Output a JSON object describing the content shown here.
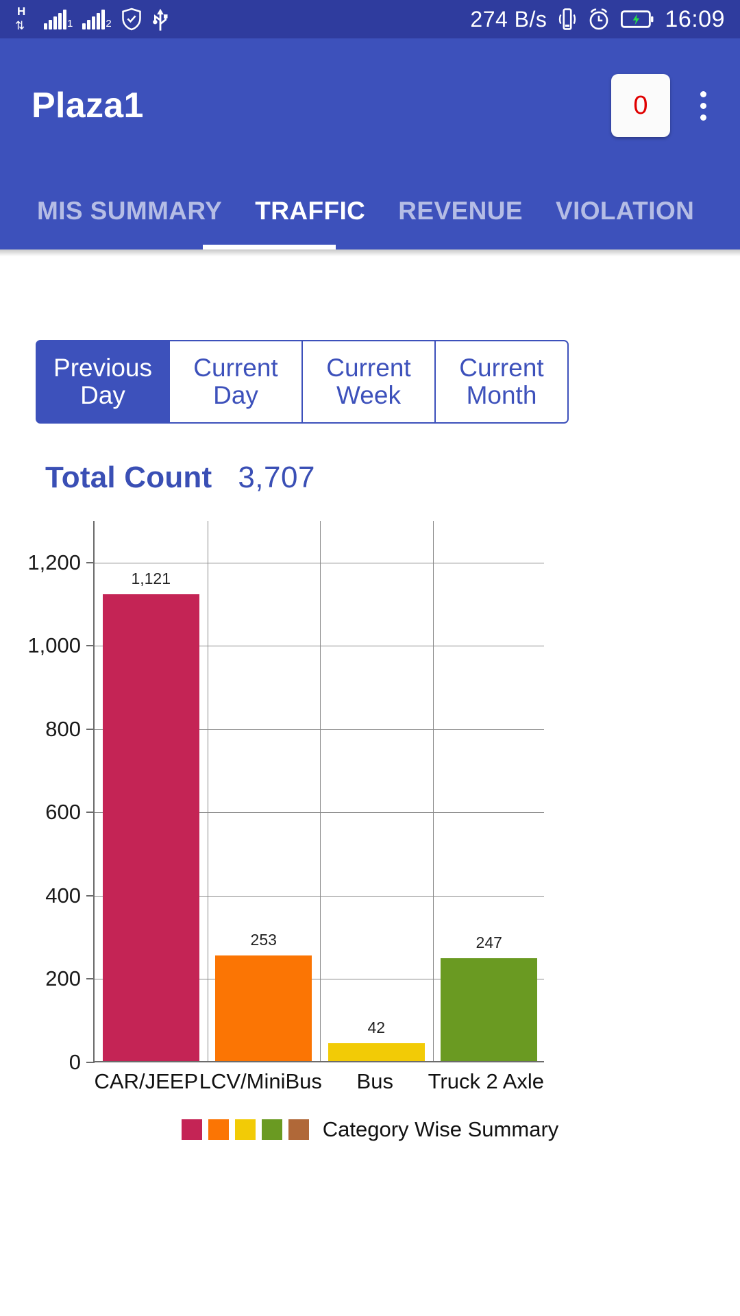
{
  "status_bar": {
    "network_type": "H",
    "data_speed": "274 B/s",
    "time": "16:09",
    "sim1_label": "1",
    "sim2_label": "2",
    "icons": [
      "h-data-icon",
      "signal-bars-sim1-icon",
      "signal-bars-sim2-icon",
      "shield-icon",
      "usb-icon",
      "vibrate-icon",
      "alarm-icon",
      "battery-charging-icon"
    ]
  },
  "app_bar": {
    "title": "Plaza1",
    "badge_count": "0",
    "badge_color": "#e00000",
    "overflow_label": "More options"
  },
  "tabs": {
    "items": [
      {
        "label": "MIS SUMMARY",
        "active": false
      },
      {
        "label": "TRAFFIC",
        "active": true
      },
      {
        "label": "REVENUE",
        "active": false
      },
      {
        "label": "VIOLATION",
        "active": false
      }
    ],
    "active_index": 1
  },
  "period_selector": {
    "options": [
      {
        "line1": "Previous",
        "line2": "Day",
        "selected": true
      },
      {
        "line1": "Current",
        "line2": "Day",
        "selected": false
      },
      {
        "line1": "Current",
        "line2": "Week",
        "selected": false
      },
      {
        "line1": "Current",
        "line2": "Month",
        "selected": false
      }
    ]
  },
  "summary": {
    "total_count_label": "Total Count",
    "total_count_value": "3,707"
  },
  "theme": {
    "status_bar_blue": "#2F3C9E",
    "primary_blue": "#3D51BB",
    "text_blue": "#3A4FB5"
  },
  "chart_data": {
    "type": "bar",
    "title": "",
    "legend_label": "Category Wise Summary",
    "legend_position": "bottom-center",
    "legend_colors": [
      "#C42455",
      "#FB7504",
      "#F2CB06",
      "#6A9A22",
      "#B06838"
    ],
    "categories": [
      "CAR/JEEP",
      "LCV/MiniBus",
      "Bus",
      "Truck 2 Axle"
    ],
    "values": [
      1121,
      253,
      42,
      247
    ],
    "value_labels": [
      "1,121",
      "253",
      "42",
      "247"
    ],
    "colors": [
      "#C42455",
      "#FB7504",
      "#F2CB06",
      "#6A9A22"
    ],
    "xlabel": "",
    "ylabel": "",
    "ylim": [
      0,
      1300
    ],
    "yticks": [
      0,
      200,
      400,
      600,
      800,
      1000,
      1200
    ],
    "ytick_labels": [
      "0",
      "200",
      "400",
      "600",
      "800",
      "1,000",
      "1,200"
    ],
    "grid": true
  }
}
